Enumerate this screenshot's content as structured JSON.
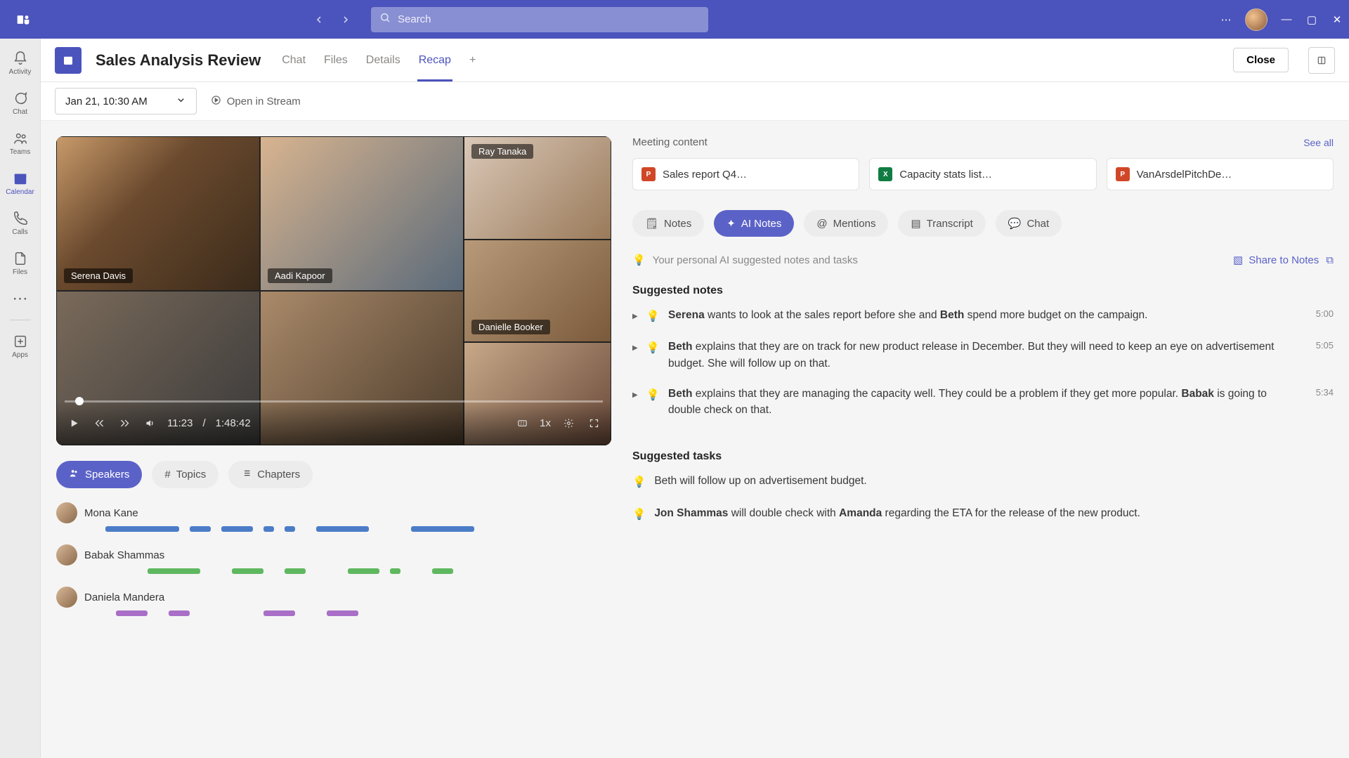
{
  "titlebar": {
    "search_placeholder": "Search"
  },
  "rail": {
    "items": [
      {
        "label": "Activity"
      },
      {
        "label": "Chat"
      },
      {
        "label": "Teams"
      },
      {
        "label": "Calendar"
      },
      {
        "label": "Calls"
      },
      {
        "label": "Files"
      }
    ],
    "more": "…",
    "apps": "Apps"
  },
  "header": {
    "title": "Sales Analysis Review",
    "tabs": [
      "Chat",
      "Files",
      "Details",
      "Recap"
    ],
    "active_tab": "Recap",
    "close": "Close"
  },
  "subheader": {
    "date": "Jan 21, 10:30 AM",
    "open_stream": "Open in Stream"
  },
  "video": {
    "participants": [
      "Serena Davis",
      "Aadi Kapoor",
      "Ray Tanaka",
      "Danielle Booker"
    ],
    "time_current": "11:23",
    "time_total": "1:48:42",
    "speed": "1x"
  },
  "recap_tabs": [
    "Speakers",
    "Topics",
    "Chapters"
  ],
  "speakers": [
    {
      "name": "Mona Kane"
    },
    {
      "name": "Babak Shammas"
    },
    {
      "name": "Daniela Mandera"
    }
  ],
  "right": {
    "meeting_content": "Meeting content",
    "see_all": "See all",
    "files": [
      {
        "type": "pp",
        "name": "Sales report Q4…"
      },
      {
        "type": "xl",
        "name": "Capacity stats list…"
      },
      {
        "type": "pp",
        "name": "VanArsdelPitchDe…"
      }
    ],
    "tabs": [
      "Notes",
      "AI Notes",
      "Mentions",
      "Transcript",
      "Chat"
    ],
    "active_tab": "AI Notes",
    "ai_hint": "Your personal AI suggested notes and tasks",
    "share": "Share to Notes",
    "suggested_notes_title": "Suggested notes",
    "notes": [
      {
        "html": "<b>Serena</b> wants to look at the sales report before she and <b>Beth</b> spend more budget on the campaign.",
        "ts": "5:00"
      },
      {
        "html": "<b>Beth</b> explains that they are on track for new product release in December. But they will need to keep an eye on advertisement budget. She will follow up on that.",
        "ts": "5:05"
      },
      {
        "html": "<b>Beth</b> explains that they are managing the capacity well. They could be a problem if they get more popular. <b>Babak</b> is going to double check on that.",
        "ts": "5:34"
      }
    ],
    "suggested_tasks_title": "Suggested tasks",
    "tasks": [
      {
        "html": "Beth will follow up on advertisement budget."
      },
      {
        "html": "<b>Jon Shammas</b> will double check with <b>Amanda</b> regarding the ETA for the release of the new product."
      }
    ]
  }
}
